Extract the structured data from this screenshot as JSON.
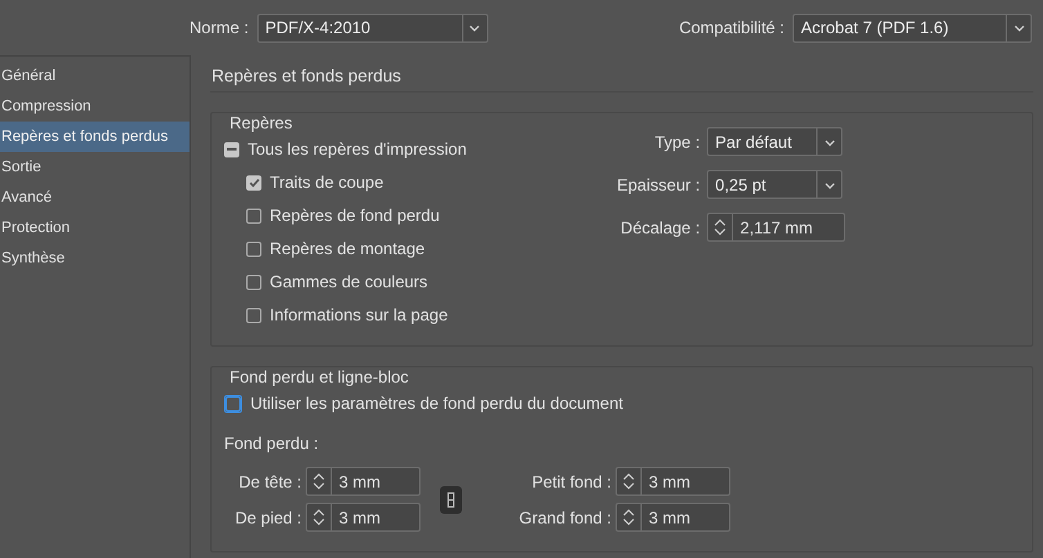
{
  "header": {
    "fields": [
      {
        "label": "Norme :",
        "value": "PDF/X-4:2010"
      },
      {
        "label": "Compatibilité :",
        "value": "Acrobat 7 (PDF 1.6)"
      }
    ]
  },
  "sidebar": {
    "items": [
      {
        "label": "Général",
        "selected": false
      },
      {
        "label": "Compression",
        "selected": false
      },
      {
        "label": "Repères et fonds perdus",
        "selected": true
      },
      {
        "label": "Sortie",
        "selected": false
      },
      {
        "label": "Avancé",
        "selected": false
      },
      {
        "label": "Protection",
        "selected": false
      },
      {
        "label": "Synthèse",
        "selected": false
      }
    ]
  },
  "section_title": "Repères et fonds perdus",
  "marks_group": {
    "title": "Repères",
    "all_marks": {
      "label": "Tous les repères d'impression",
      "mixed": true
    },
    "options": [
      {
        "label": "Traits de coupe",
        "checked": true
      },
      {
        "label": "Repères de fond perdu",
        "checked": false
      },
      {
        "label": "Repères de montage",
        "checked": false
      },
      {
        "label": "Gammes de couleurs",
        "checked": false
      },
      {
        "label": "Informations sur la page",
        "checked": false
      }
    ],
    "settings": [
      {
        "label": "Type :",
        "value": "Par défaut",
        "kind": "dropdown"
      },
      {
        "label": "Epaisseur :",
        "value": "0,25 pt",
        "kind": "dropdown"
      },
      {
        "label": "Décalage :",
        "value": "2,117 mm",
        "kind": "spinner"
      }
    ]
  },
  "bleed_group": {
    "title": "Fond perdu et ligne-bloc",
    "use_document": {
      "label": "Utiliser les paramètres de fond perdu du document",
      "checked": false,
      "focused": true
    },
    "subtitle": "Fond perdu :",
    "left_fields": [
      {
        "label": "De tête :",
        "value": "3 mm"
      },
      {
        "label": "De pied :",
        "value": "3 mm"
      }
    ],
    "right_fields": [
      {
        "label": "Petit fond :",
        "value": "3 mm"
      },
      {
        "label": "Grand fond :",
        "value": "3 mm"
      }
    ]
  }
}
